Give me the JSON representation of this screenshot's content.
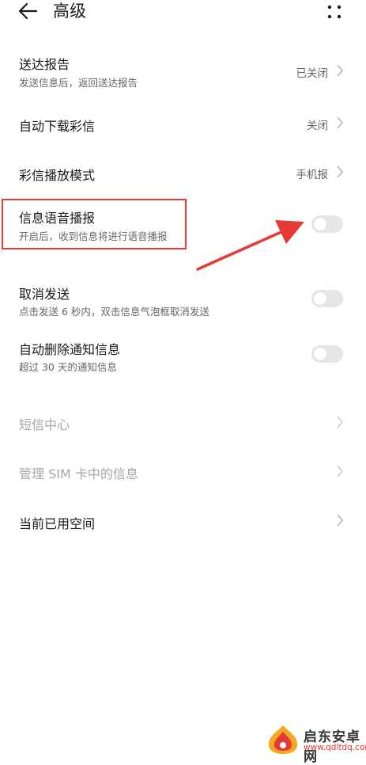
{
  "header": {
    "title": "高级"
  },
  "rows": [
    {
      "id": "delivery-report",
      "title": "送达报告",
      "subtitle": "发送信息后，返回送达报告",
      "value": "已关闭"
    },
    {
      "id": "auto-download-mms",
      "title": "自动下载彩信",
      "value": "关闭"
    },
    {
      "id": "mms-playback-mode",
      "title": "彩信播放模式",
      "value": "手机报"
    },
    {
      "id": "message-voice-broadcast",
      "title": "信息语音播报",
      "subtitle": "开启后，收到信息将进行语音播报",
      "toggle": false
    },
    {
      "id": "cancel-send",
      "title": "取消发送",
      "subtitle": "点击发送 6 秒内，双击信息气泡框取消发送",
      "toggle": false
    },
    {
      "id": "auto-delete-notifications",
      "title": "自动删除通知信息",
      "subtitle": "超过 30 天的通知信息",
      "toggle": false
    },
    {
      "id": "sms-center",
      "title": "短信中心",
      "disabled": true
    },
    {
      "id": "manage-sim-messages",
      "title": "管理 SIM 卡中的信息",
      "disabled": true
    },
    {
      "id": "storage-used",
      "title": "当前已用空间"
    }
  ],
  "watermark": {
    "name": "启东安卓网",
    "url": "www.qdltdq.com"
  },
  "colors": {
    "annotation_red": "#e53935",
    "toggle_off": "#e6e6e6",
    "disabled_text": "#a6a6a6"
  }
}
